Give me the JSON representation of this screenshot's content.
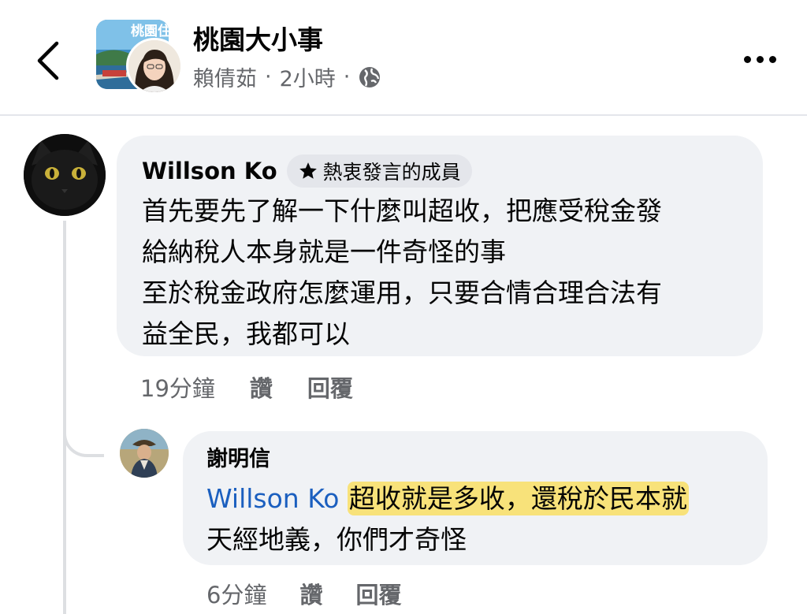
{
  "header": {
    "group_name": "桃園大小事",
    "group_avatar_text": "桃園住",
    "poster_name": "賴倩茹",
    "separator": "·",
    "post_time": "2小時",
    "privacy_icon": "globe-icon",
    "back_icon": "chevron-left-icon",
    "more_icon": "more-horizontal-icon"
  },
  "comments": [
    {
      "author": "Willson Ko",
      "badge_icon": "star-icon",
      "badge": "熱衷發言的成員",
      "lines": [
        "首先要先了解一下什麼叫超收，把應受稅金發",
        "給納稅人本身就是一件奇怪的事",
        "至於稅金政府怎麼運用，只要合情合理合法有",
        "益全民，我都可以"
      ],
      "time": "19分鐘",
      "like_label": "讚",
      "reply_label": "回覆"
    },
    {
      "author": "謝明信",
      "mention": "Willson Ko",
      "highlighted_text": "超收就是多收，還稅於民本就",
      "line2": "天經地義，你們才奇怪",
      "time": "6分鐘",
      "like_label": "讚",
      "reply_label": "回覆"
    }
  ],
  "colors": {
    "bubble": "#f0f2f5",
    "mention": "#1b5fbf",
    "highlight": "#f8e27a",
    "muted": "#65676b"
  }
}
